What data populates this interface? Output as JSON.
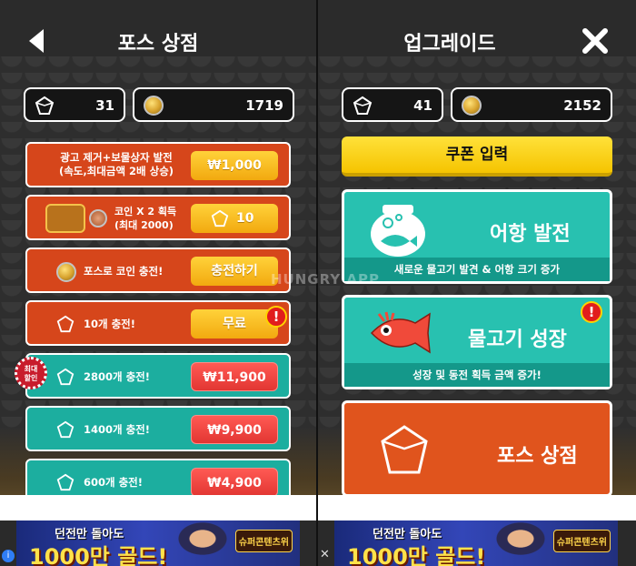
{
  "left": {
    "title": "포스 상점",
    "gems": "31",
    "coins": "1719",
    "rows": [
      {
        "label": "광고 제거+보물상자 발전\n(속도,최대금액 2배 상승)",
        "button": "₩1,000"
      },
      {
        "label": "코인 X 2 획득\n(최대 2000)",
        "button": "10"
      },
      {
        "label": "포스로 코인 충전!",
        "button": "충전하기"
      },
      {
        "label": "10개 충전!",
        "button": "무료",
        "alert": "!"
      },
      {
        "label": "2800개 충전!",
        "button": "₩11,900"
      },
      {
        "label": "1400개 충전!",
        "button": "₩9,900"
      },
      {
        "label": "600개 충전!",
        "button": "₩4,900"
      }
    ],
    "badge": "최대\n할인"
  },
  "right": {
    "title": "업그레이드",
    "gems": "41",
    "coins": "2152",
    "coupon": "쿠폰 입력",
    "cards": [
      {
        "heading": "어항 발전",
        "caption": "새로운 물고기 발견 & 어항 크기 증가"
      },
      {
        "heading": "물고기 성장",
        "caption": "성장 및 동전 획득 금액 증가!",
        "alert": "!"
      },
      {
        "heading": "포스 상점"
      }
    ]
  },
  "watermark": "HUNGRY APP",
  "ad": {
    "line1": "던전만 돌아도",
    "line2": "1000만 골드!",
    "logo": "슈퍼콘텐츠위",
    "close": "✕",
    "info": "i"
  },
  "colors": {
    "orange": "#d6461b",
    "teal": "#1cae9f",
    "yellow": "#f5c400",
    "red": "#e23632"
  }
}
